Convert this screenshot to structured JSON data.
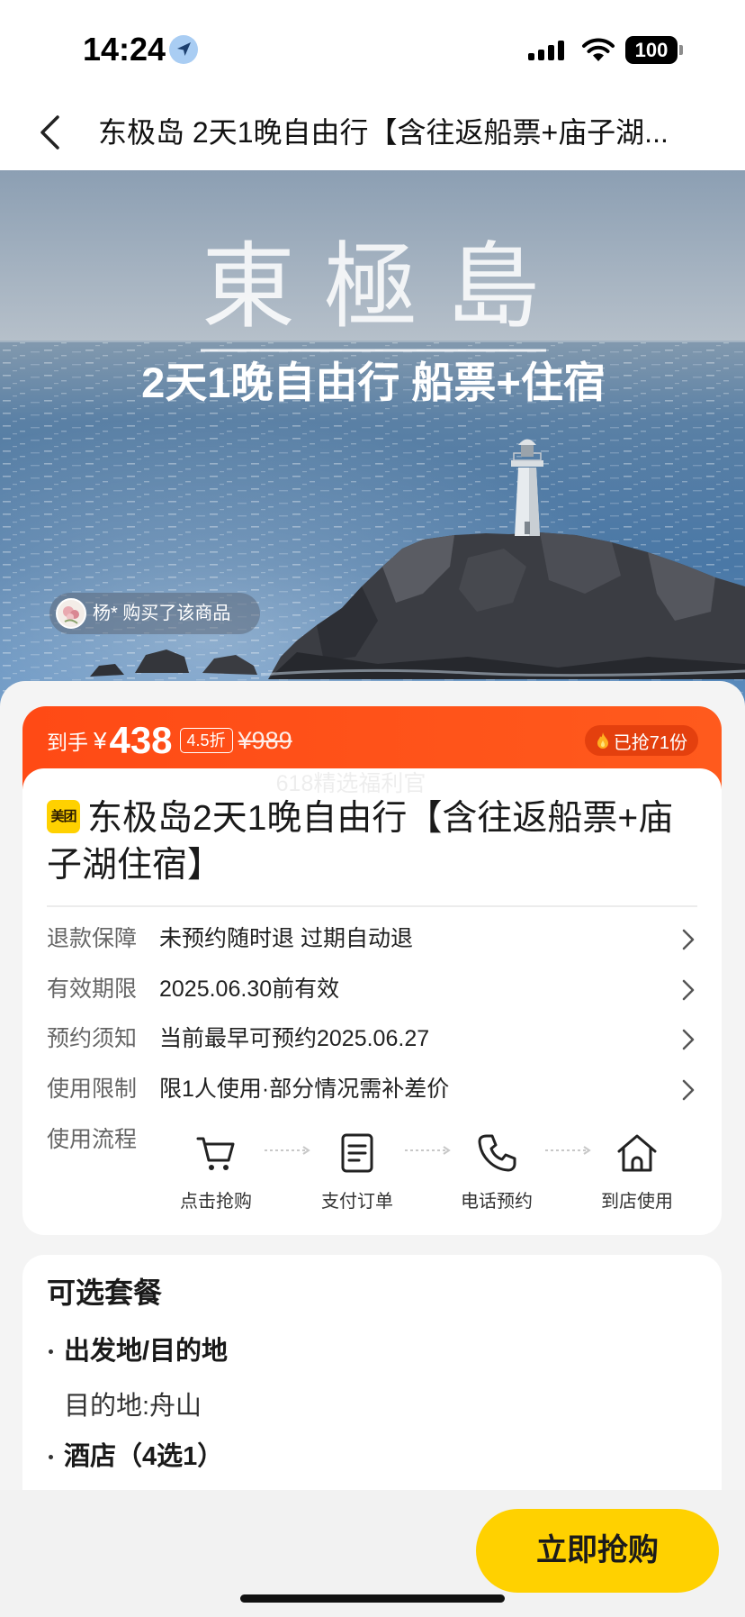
{
  "status_bar": {
    "time": "14:24",
    "battery": "100",
    "icons": [
      "location-arrow-icon",
      "signal-icon",
      "wifi-icon",
      "battery-icon"
    ]
  },
  "nav": {
    "back_icon": "chevron-left-icon",
    "title": "东极岛 2天1晚自由行【含往返船票+庙子湖..."
  },
  "hero": {
    "headline": "東極島",
    "subtitle": "2天1晚自由行 船票+住宿",
    "buyer_notice": "杨* 购买了该商品"
  },
  "price_banner": {
    "label": "到手",
    "currency": "¥",
    "price": "438",
    "discount": "4.5折",
    "original_price": "¥989",
    "sold": "已抢71份",
    "sold_icon": "flame-icon"
  },
  "watermark": "618精选福利官",
  "product": {
    "badge": "美团",
    "title": "东极岛2天1晚自由行【含往返船票+庙子湖住宿】"
  },
  "info_rows": [
    {
      "label": "退款保障",
      "value": "未预约随时退 过期自动退"
    },
    {
      "label": "有效期限",
      "value": "2025.06.30前有效"
    },
    {
      "label": "预约须知",
      "value": "当前最早可预约2025.06.27"
    },
    {
      "label": "使用限制",
      "value": "限1人使用·部分情况需补差价"
    }
  ],
  "process": {
    "label": "使用流程",
    "steps": [
      {
        "label": "点击抢购",
        "icon": "cart-icon"
      },
      {
        "label": "支付订单",
        "icon": "order-document-icon"
      },
      {
        "label": "电话预约",
        "icon": "phone-icon"
      },
      {
        "label": "到店使用",
        "icon": "store-home-icon"
      }
    ]
  },
  "packages": {
    "heading": "可选套餐",
    "groups": [
      {
        "title": "出发地/目的地",
        "detail": "目的地:舟山"
      },
      {
        "title": "酒店（4选1）"
      }
    ]
  },
  "cta": {
    "label": "立即抢购"
  },
  "colors": {
    "price_banner": "#ff4a15",
    "sold_pill": "#e4400e",
    "cta_button": "#ffd100",
    "brand_badge": "#ffd100"
  }
}
